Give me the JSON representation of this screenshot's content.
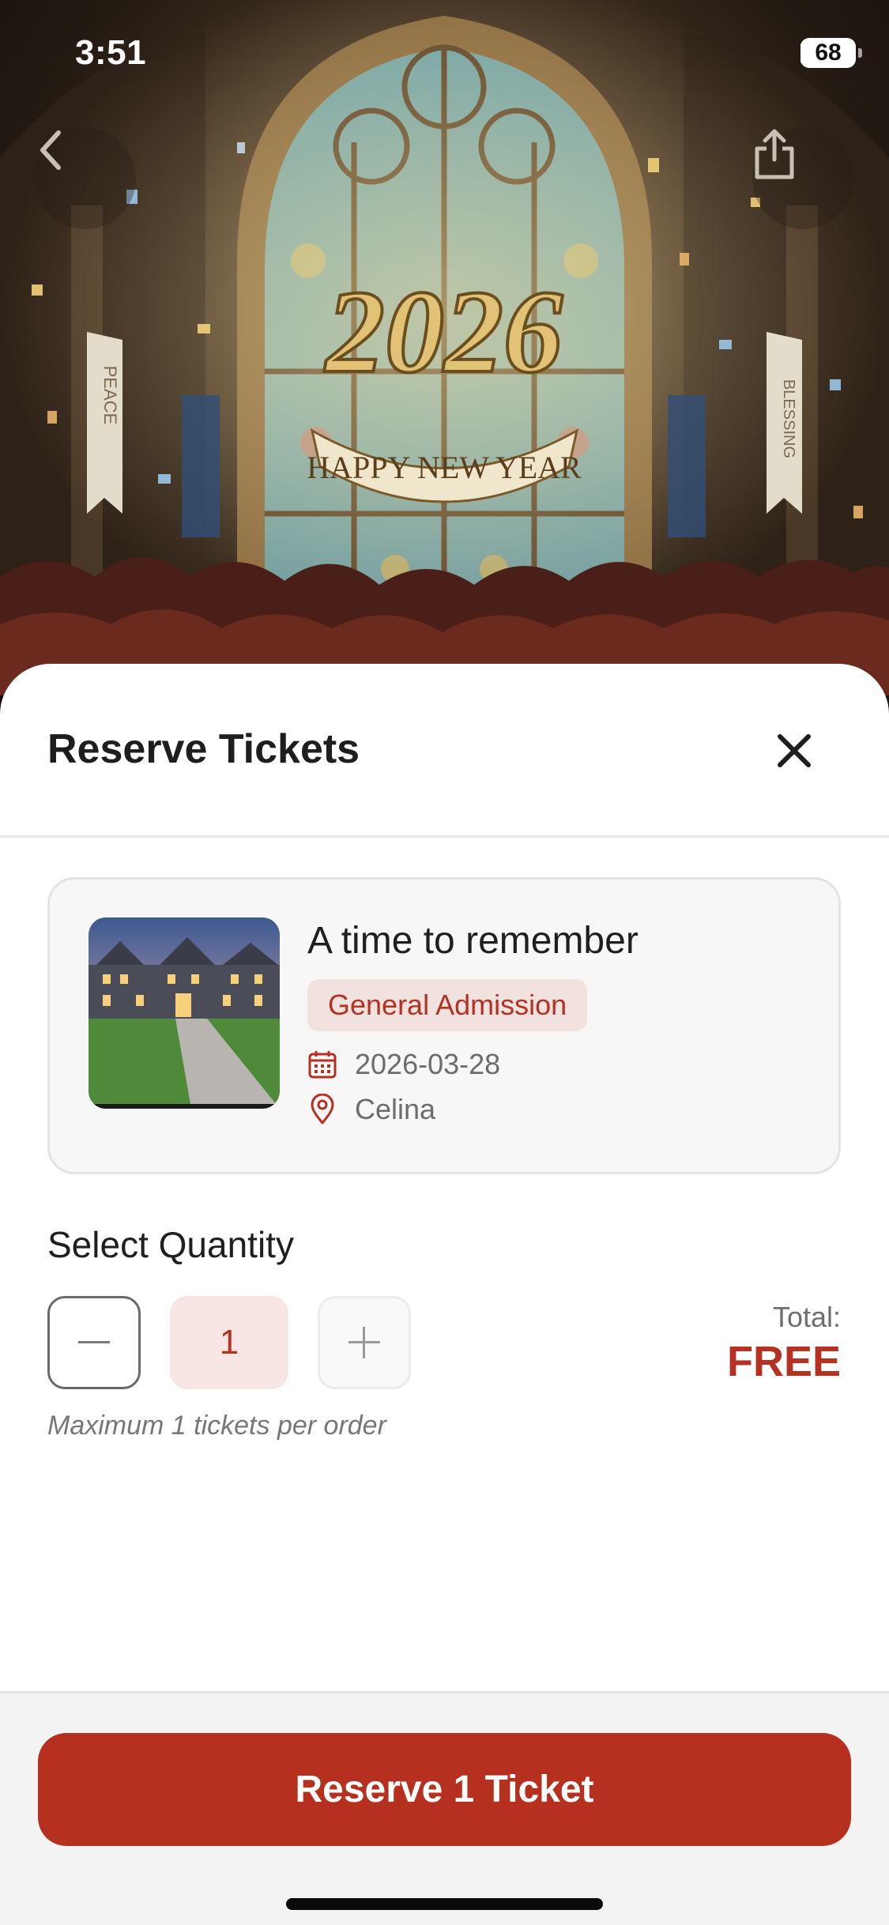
{
  "status_bar": {
    "time": "3:51",
    "battery": "68"
  },
  "hero": {
    "banner_year": "2026",
    "banner_text": "HAPPY NEW YEAR",
    "left_banner": "PEACE",
    "right_banner": "BLESSING"
  },
  "sheet": {
    "title": "Reserve Tickets",
    "event": {
      "name": "A time to remember",
      "ticket_type": "General Admission",
      "date": "2026-03-28",
      "location": "Celina"
    },
    "quantity": {
      "title": "Select Quantity",
      "value": "1",
      "max_note": "Maximum 1 tickets per order"
    },
    "total": {
      "label": "Total:",
      "value": "FREE"
    }
  },
  "footer": {
    "button_label": "Reserve 1 Ticket"
  },
  "colors": {
    "accent": "#b5301f",
    "badge_bg": "#f1e2df",
    "qty_bg": "#f8e6e4"
  },
  "icons": {
    "back": "chevron-left-icon",
    "share": "share-icon",
    "close": "close-icon",
    "date": "calendar-icon",
    "location": "map-pin-icon",
    "decrease": "minus-icon",
    "increase": "plus-icon"
  }
}
